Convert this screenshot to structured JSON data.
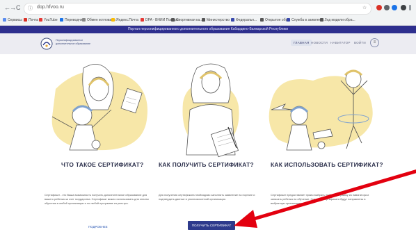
{
  "browser": {
    "back_glyph": "←",
    "forward_glyph": "→",
    "reload_glyph": "C",
    "lock_glyph": "ⓘ",
    "url": "dop.hfvoo.ru",
    "star_glyph": "☆",
    "bookmarks": [
      {
        "label": "Сервисы",
        "color": "#5b8def"
      },
      {
        "label": "Почта",
        "color": "#d93025"
      },
      {
        "label": "YouTube",
        "color": "#e53935"
      },
      {
        "label": "Переводчик",
        "color": "#1a73e8"
      },
      {
        "label": "Обмен котлована",
        "color": "#888888"
      },
      {
        "label": "Яндекс.Почта",
        "color": "#fbbc04"
      },
      {
        "label": "DPA - ВНИИ Пожарн.",
        "color": "#e53935"
      },
      {
        "label": "Спортивная ка...",
        "color": "#555555"
      },
      {
        "label": "Министерство",
        "color": "#555555"
      },
      {
        "label": "Федеральн...",
        "color": "#3949ab"
      },
      {
        "label": "Открытое обр...",
        "color": "#555555"
      },
      {
        "label": "Служба в заявлени...",
        "color": "#3949ab"
      },
      {
        "label": "Гид модели обра...",
        "color": "#555555"
      }
    ]
  },
  "site": {
    "top_strip": "Портал персонифицированного дополнительного образования Кабардино-Балкарской Республики",
    "logo_text": "Персонифицированное дополнительное образование",
    "menu": [
      "ГЛАВНАЯ",
      "НОВОСТИ",
      "НАВИГАТОР",
      "ВОЙТИ"
    ],
    "menu_button_glyph": "≡"
  },
  "cards": [
    {
      "title": "ЧТО ТАКОЕ СЕРТИФИКАТ?",
      "body": "Сертификат - это Ваша возможность получить дополнительное образование для вашего ребенка за счет государства. Сертификат можно использовать для оплаты обучения в любой организации и по любой программе из реестра.",
      "link": "ПОДРОБНЕЕ"
    },
    {
      "title": "КАК ПОЛУЧИТЬ СЕРТИФИКАТ?",
      "body": "Для получения сертификата необходимо заполнить заявление на портале и подтвердить данные в уполномоченной организации.",
      "button": "ПОЛУЧИТЬ СЕРТИФИКАТ"
    },
    {
      "title": "КАК ИСПОЛЬЗОВАТЬ СЕРТИФИКАТ?",
      "body": "Сертификат предоставляет право выбрать любую программу из навигатора и записать ребенка на обучение. Средства сертификата будут направлены в выбранную организацию."
    }
  ],
  "colors": {
    "accent": "#2e3a8c",
    "arrow": "#e3000f",
    "illustration_blob": "#f7e7a8"
  }
}
